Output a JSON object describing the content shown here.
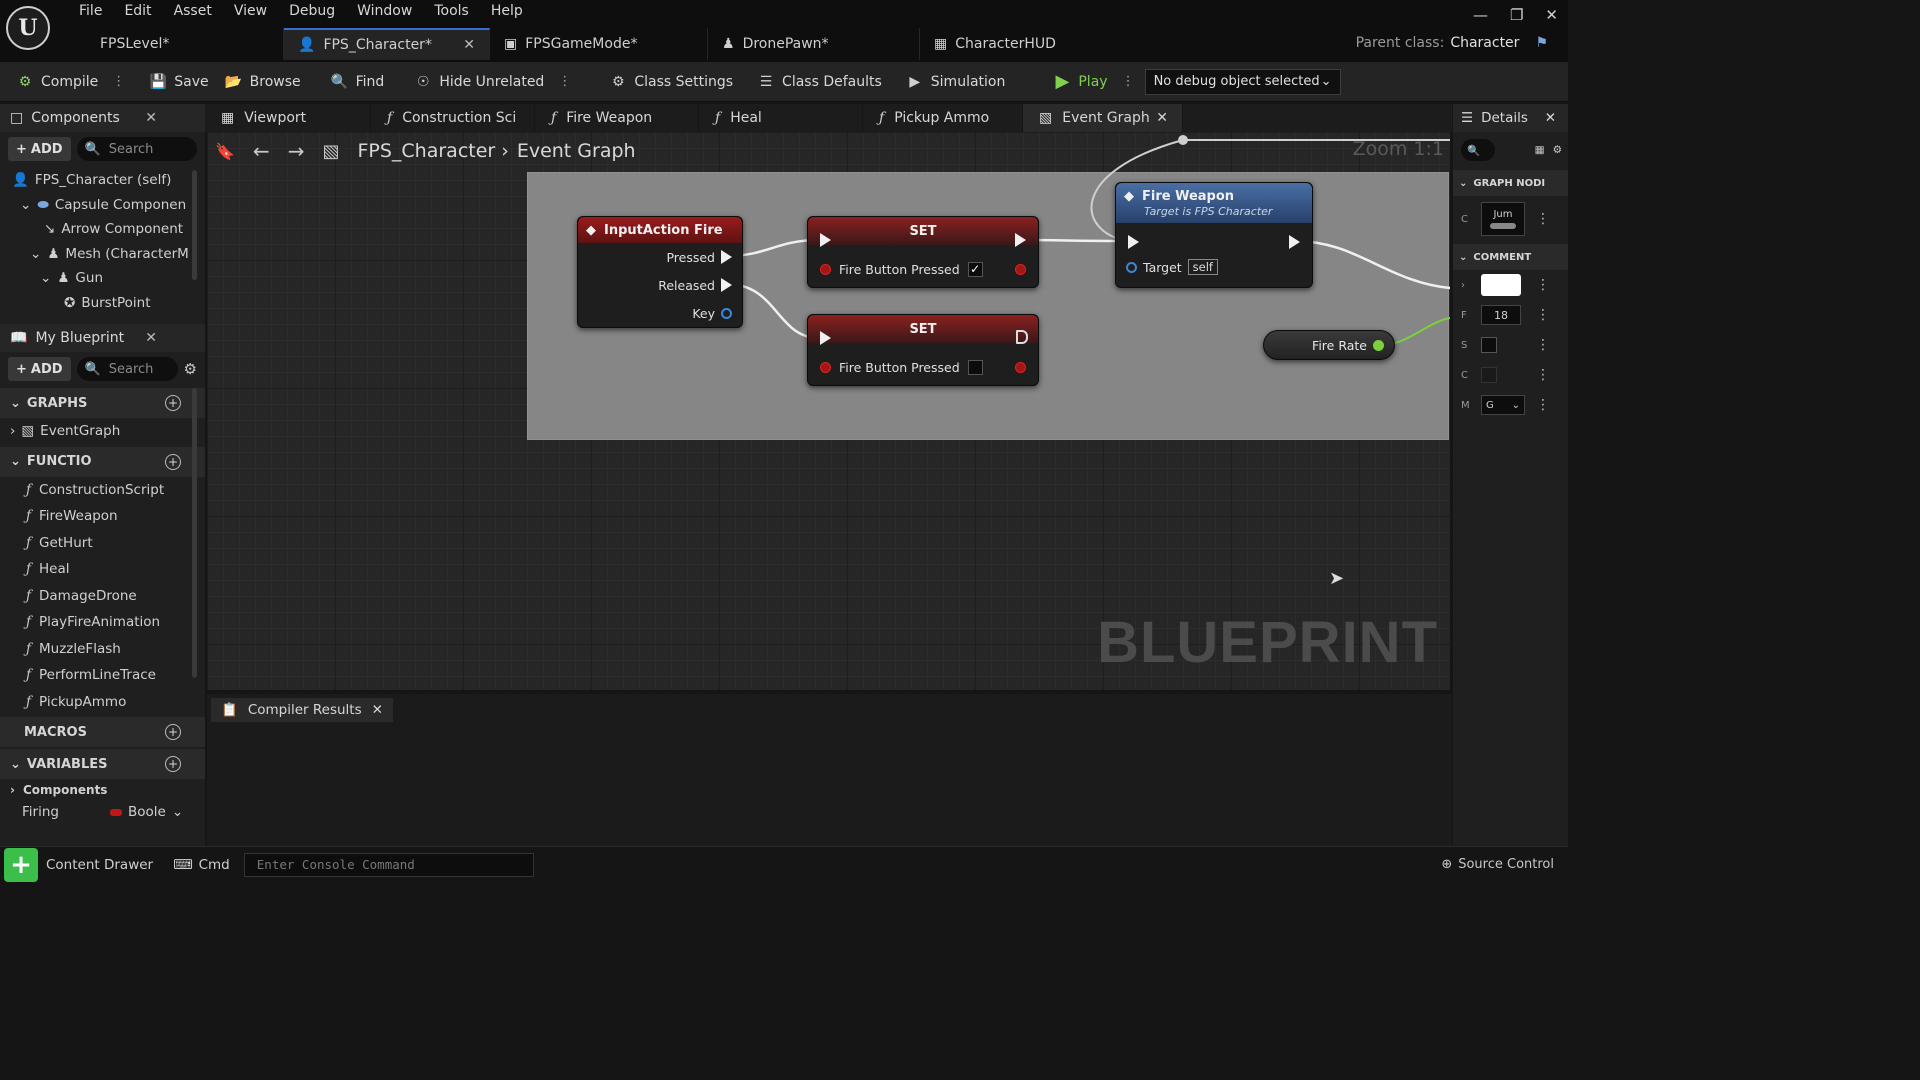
{
  "menu": [
    "File",
    "Edit",
    "Asset",
    "View",
    "Debug",
    "Window",
    "Tools",
    "Help"
  ],
  "doc_tabs": [
    {
      "label": "FPSLevel*"
    },
    {
      "label": "FPS_Character*"
    },
    {
      "label": "FPSGameMode*"
    },
    {
      "label": "DronePawn*"
    },
    {
      "label": "CharacterHUD"
    }
  ],
  "parent_class": {
    "label": "Parent class:",
    "value": "Character"
  },
  "toolbar": {
    "compile": "Compile",
    "save": "Save",
    "browse": "Browse",
    "find": "Find",
    "hide_unrelated": "Hide Unrelated",
    "class_settings": "Class Settings",
    "class_defaults": "Class Defaults",
    "simulation": "Simulation",
    "play": "Play",
    "debug_select": "No debug object selected"
  },
  "components_panel": {
    "tab": "Components",
    "add": "ADD",
    "search_placeholder": "Search",
    "tree": [
      "FPS_Character (self)",
      "Capsule Componen",
      "Arrow Component",
      "Mesh (CharacterM",
      "Gun",
      "BurstPoint"
    ]
  },
  "my_blueprint": {
    "tab": "My Blueprint",
    "add": "ADD",
    "search_placeholder": "Search",
    "graphs_header": "GRAPHS",
    "event_graph": "EventGraph",
    "functions_header": "FUNCTIO",
    "functions": [
      "ConstructionScript",
      "FireWeapon",
      "GetHurt",
      "Heal",
      "DamageDrone",
      "PlayFireAnimation",
      "MuzzleFlash",
      "PerformLineTrace",
      "PickupAmmo"
    ],
    "macros_header": "MACROS",
    "variables_header": "VARIABLES",
    "components_cat": "Components",
    "var_name": "Firing",
    "var_type": "Boole"
  },
  "graph_tabs": [
    "Viewport",
    "Construction Sci",
    "Fire Weapon",
    "Heal",
    "Pickup Ammo",
    "Event Graph"
  ],
  "breadcrumb": {
    "root": "FPS_Character",
    "current": "Event Graph"
  },
  "zoom": "Zoom 1:1",
  "watermark": "BLUEPRINT",
  "nodes": {
    "input_action": {
      "title": "InputAction Fire",
      "pressed": "Pressed",
      "released": "Released",
      "key": "Key"
    },
    "set1": {
      "title": "SET",
      "var": "Fire Button Pressed"
    },
    "set2": {
      "title": "SET",
      "var": "Fire Button Pressed"
    },
    "fire_weapon": {
      "title": "Fire Weapon",
      "subtitle": "Target is FPS Character",
      "target": "Target",
      "self": "self"
    },
    "fire_rate": {
      "label": "Fire Rate"
    }
  },
  "compiler_tab": "Compiler Results",
  "details": {
    "tab": "Details",
    "graph_node": "GRAPH NODI",
    "comment": "COMMENT",
    "rows": [
      {
        "label": "C",
        "value": "Jum"
      },
      {
        "label": "",
        "value": ""
      },
      {
        "label": "F",
        "value": "18"
      },
      {
        "label": "S",
        "value": ""
      },
      {
        "label": "C",
        "value": ""
      },
      {
        "label": "M",
        "value": "G"
      }
    ]
  },
  "statusbar": {
    "content_drawer": "Content Drawer",
    "cmd": "Cmd",
    "console_placeholder": "Enter Console Command",
    "source_control": "Source Control"
  },
  "colors": {
    "exec": "#f0f0f0",
    "bool": "#a31616",
    "event_head": "#8a1a1a",
    "func_head": "#3d5a88",
    "var": "#7cd03b"
  }
}
